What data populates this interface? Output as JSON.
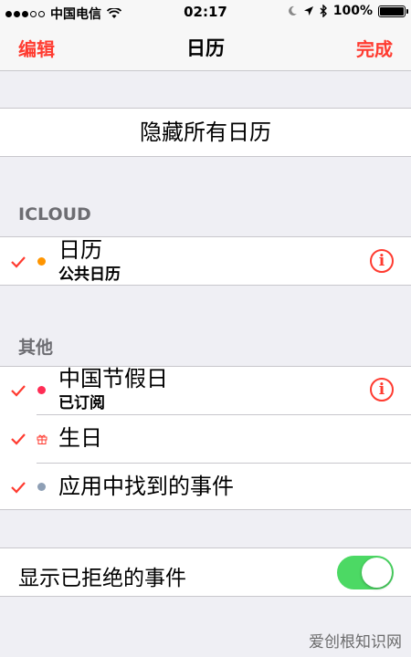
{
  "status_bar": {
    "carrier": "中国电信",
    "time": "02:17",
    "battery": "100%",
    "icons": [
      "signal-dots",
      "wifi-icon",
      "moon-icon",
      "location-arrow-icon",
      "bluetooth-icon",
      "battery-icon"
    ]
  },
  "nav": {
    "left_label": "编辑",
    "title": "日历",
    "right_label": "完成"
  },
  "hide_all_label": "隐藏所有日历",
  "sections": {
    "icloud_header": "ICLOUD",
    "other_header": "其他"
  },
  "calendars": [
    {
      "name": "日历",
      "subtitle": "公共日历",
      "color": "#ff9500",
      "checked": true,
      "has_info": true
    },
    {
      "name": "中国节假日",
      "subtitle": "已订阅",
      "color": "#ff2d55",
      "checked": true,
      "has_info": true
    },
    {
      "name": "生日",
      "subtitle": "",
      "color": "#ff3b30",
      "checked": true,
      "has_info": false,
      "icon": "gift-icon"
    },
    {
      "name": "应用中找到的事件",
      "subtitle": "",
      "color": "#8e9fb5",
      "checked": true,
      "has_info": false
    }
  ],
  "show_declined": {
    "label": "显示已拒绝的事件",
    "enabled": true
  },
  "colors": {
    "accent": "#ff3b30",
    "toggle_on": "#4cd964",
    "background": "#efeff4"
  },
  "watermark": "爱创根知识网"
}
